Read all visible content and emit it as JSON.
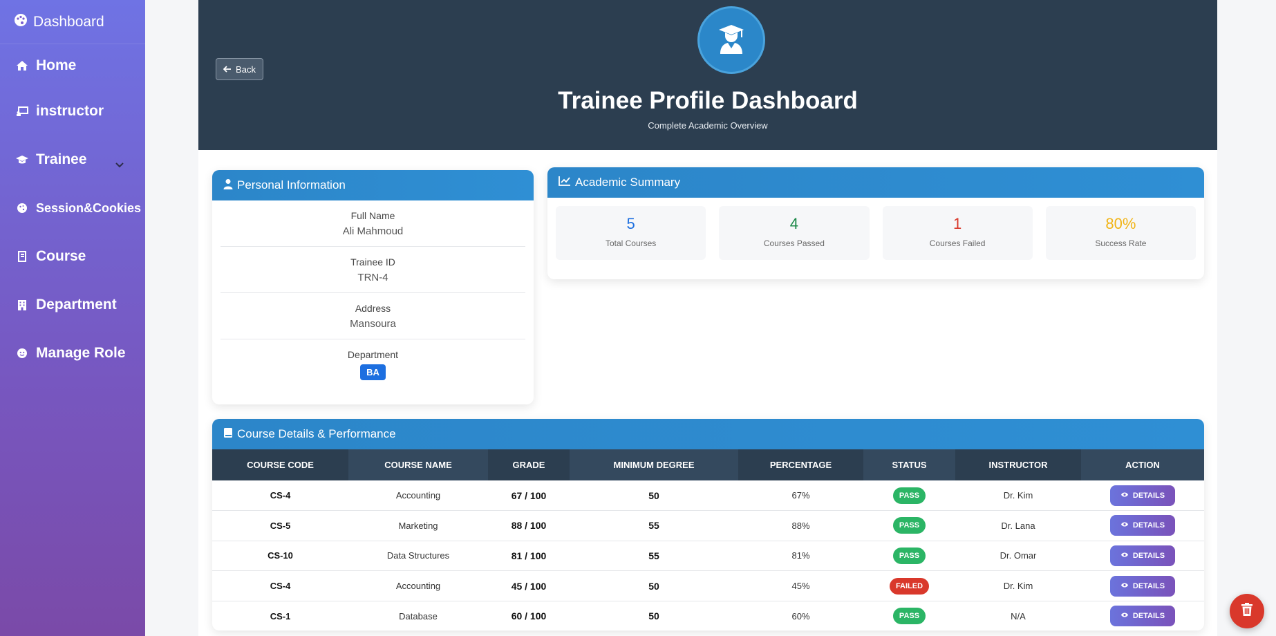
{
  "sidebar": {
    "brand": "Dashboard",
    "items": [
      {
        "label": "Home",
        "icon": "home-icon"
      },
      {
        "label": "instructor",
        "icon": "chalkboard-icon"
      },
      {
        "label": "Trainee",
        "icon": "graduation-cap-icon"
      },
      {
        "label": "Session&Cookies",
        "icon": "cookie-icon"
      },
      {
        "label": "Course",
        "icon": "book-icon"
      },
      {
        "label": "Department",
        "icon": "building-icon"
      },
      {
        "label": "Manage Role",
        "icon": "user-role-icon"
      }
    ]
  },
  "header": {
    "back_label": "Back",
    "title": "Trainee Profile Dashboard",
    "subtitle": "Complete Academic Overview"
  },
  "personal": {
    "title": "Personal Information",
    "fields": [
      {
        "label": "Full Name",
        "value": "Ali Mahmoud"
      },
      {
        "label": "Trainee ID",
        "value": "TRN-4"
      },
      {
        "label": "Address",
        "value": "Mansoura"
      },
      {
        "label": "Department",
        "value": "BA"
      }
    ]
  },
  "academic": {
    "title": "Academic Summary",
    "stats": [
      {
        "value": "5",
        "label": "Total Courses",
        "color": "#1d6fe0"
      },
      {
        "value": "4",
        "label": "Courses Passed",
        "color": "#1e8a4a"
      },
      {
        "value": "1",
        "label": "Courses Failed",
        "color": "#d9382b"
      },
      {
        "value": "80%",
        "label": "Success Rate",
        "color": "#f1b416"
      }
    ]
  },
  "courses": {
    "title": "Course Details & Performance",
    "headers": [
      "COURSE CODE",
      "COURSE NAME",
      "GRADE",
      "MINIMUM DEGREE",
      "PERCENTAGE",
      "STATUS",
      "INSTRUCTOR",
      "ACTION"
    ],
    "action_label": "DETAILS",
    "rows": [
      {
        "code": "CS-4",
        "name": "Accounting",
        "grade": "67 / 100",
        "min": "50",
        "pct": "67%",
        "status": "PASS",
        "instructor": "Dr. Kim"
      },
      {
        "code": "CS-5",
        "name": "Marketing",
        "grade": "88 / 100",
        "min": "55",
        "pct": "88%",
        "status": "PASS",
        "instructor": "Dr. Lana"
      },
      {
        "code": "CS-10",
        "name": "Data Structures",
        "grade": "81 / 100",
        "min": "55",
        "pct": "81%",
        "status": "PASS",
        "instructor": "Dr. Omar"
      },
      {
        "code": "CS-4",
        "name": "Accounting",
        "grade": "45 / 100",
        "min": "50",
        "pct": "45%",
        "status": "FAILED",
        "instructor": "Dr. Kim"
      },
      {
        "code": "CS-1",
        "name": "Database",
        "grade": "60 / 100",
        "min": "50",
        "pct": "60%",
        "status": "PASS",
        "instructor": "N/A"
      }
    ]
  },
  "colors": {
    "pass": "#2bb565",
    "failed": "#d9382b",
    "hero_bg": "#2c3e50",
    "card_head": "#2c86c9"
  }
}
